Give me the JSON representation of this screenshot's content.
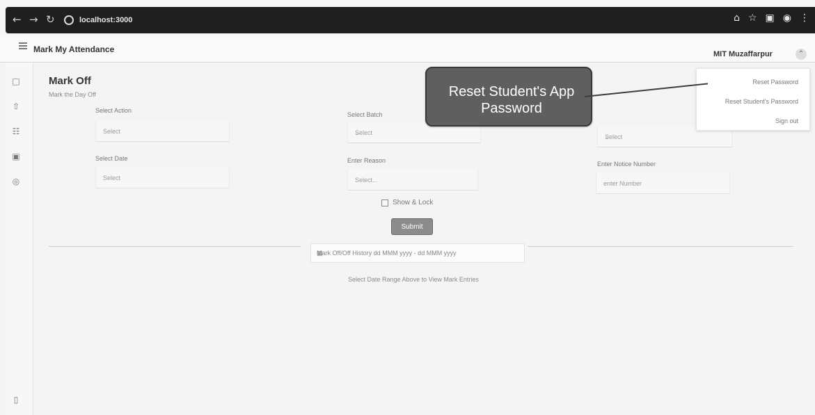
{
  "browser": {
    "url": "localhost:3000"
  },
  "header": {
    "title": "Mark My Attendance",
    "user": "MIT Muzaffarpur"
  },
  "page": {
    "title": "Mark Off",
    "subtitle": "Mark the Day Off"
  },
  "form": {
    "action_label": "Select Action",
    "action_value": "Select",
    "batch_label": "Select Batch",
    "batch_value": "Select",
    "date_label": "Select Date",
    "date_value": "Select",
    "reason_label": "Enter Reason",
    "reason_value": "Select...",
    "notice_label": "Enter Notice Number",
    "notice_value": "enter Number",
    "third_select_value": "Select",
    "checkbox_label": "Show & Lock",
    "submit_label": "Submit"
  },
  "history": {
    "range_label": "Mark Off/Off History  dd MMM yyyy - dd MMM yyyy",
    "hint": "Select Date Range Above to View Mark Entries"
  },
  "dropdown": {
    "items": [
      "Reset Password",
      "Reset Student's Password",
      "Sign out"
    ]
  },
  "tooltip": {
    "text": "Reset Student's App Password"
  },
  "icons": {
    "menu": "menu-icon",
    "user": "user-icon",
    "calendar": "calendar-icon",
    "upload": "upload-icon",
    "users": "users-icon",
    "id_card": "id-card-icon",
    "settings": "settings-icon",
    "bottom": "document-icon"
  }
}
